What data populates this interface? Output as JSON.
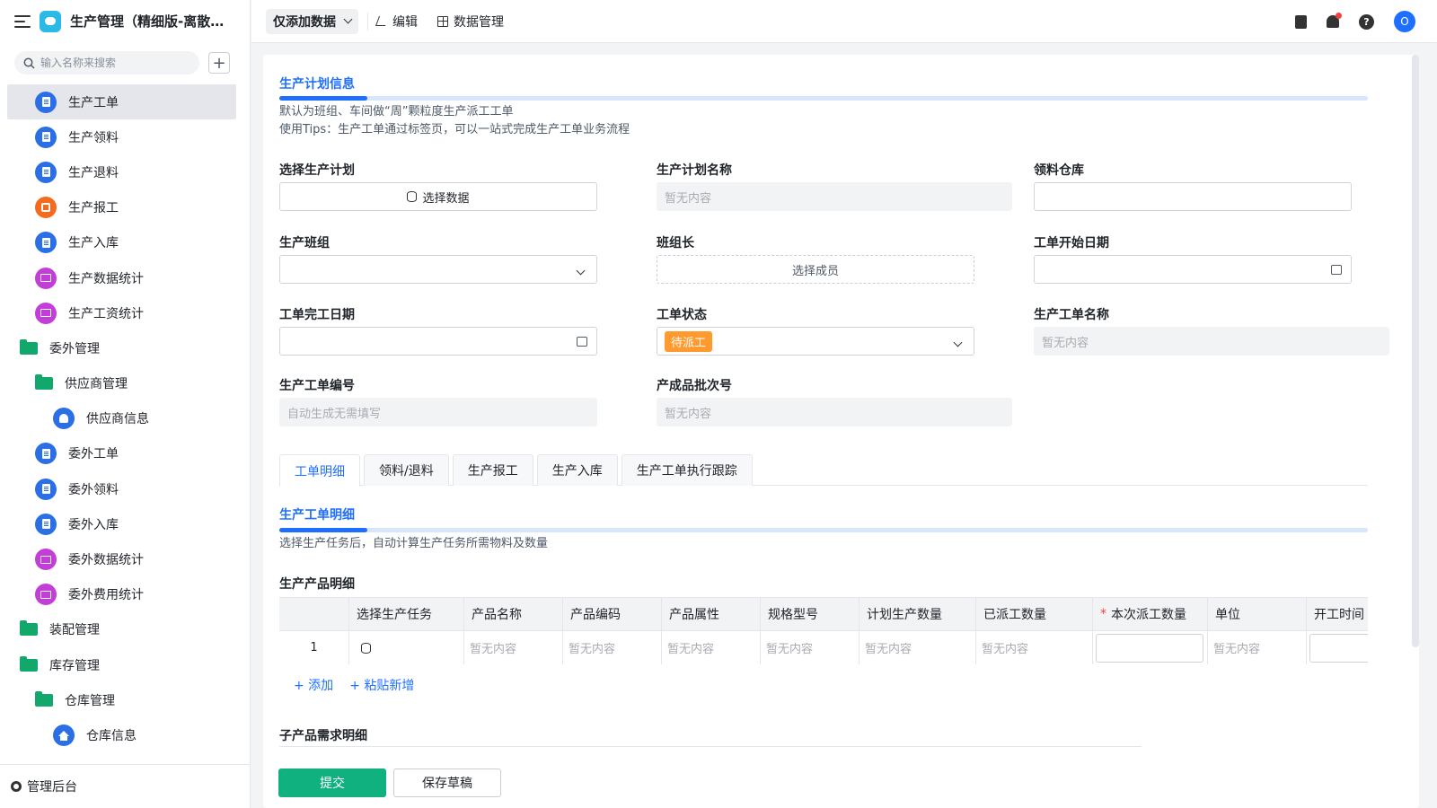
{
  "app": {
    "title": "生产管理（精细版-离散制..."
  },
  "search": {
    "placeholder": "输入名称来搜索"
  },
  "sidebar": {
    "items": [
      {
        "label": "生产工单",
        "active": true
      },
      {
        "label": "生产领料"
      },
      {
        "label": "生产退料"
      },
      {
        "label": "生产报工"
      },
      {
        "label": "生产入库"
      },
      {
        "label": "生产数据统计"
      },
      {
        "label": "生产工资统计"
      },
      {
        "label": "委外管理"
      },
      {
        "label": "供应商管理"
      },
      {
        "label": "供应商信息"
      },
      {
        "label": "委外工单"
      },
      {
        "label": "委外领料"
      },
      {
        "label": "委外入库"
      },
      {
        "label": "委外数据统计"
      },
      {
        "label": "委外费用统计"
      },
      {
        "label": "装配管理"
      },
      {
        "label": "库存管理"
      },
      {
        "label": "仓库管理"
      },
      {
        "label": "仓库信息"
      }
    ],
    "footer": "管理后台"
  },
  "topbar": {
    "mode": "仅添加数据",
    "edit": "编辑",
    "data_manage": "数据管理",
    "avatar": "O",
    "help": "?"
  },
  "plan_section": {
    "title": "生产计划信息",
    "hint1": "默认为班组、车间做“周”颗粒度生产派工工单",
    "hint2": "使用Tips：生产工单通过标签页，可以一站式完成生产工单业务流程"
  },
  "fields": {
    "select_plan": {
      "label": "选择生产计划",
      "button": "选择数据"
    },
    "plan_name": {
      "label": "生产计划名称",
      "placeholder": "暂无内容"
    },
    "warehouse": {
      "label": "领料仓库"
    },
    "team": {
      "label": "生产班组"
    },
    "team_leader": {
      "label": "班组长",
      "button": "选择成员"
    },
    "start_date": {
      "label": "工单开始日期"
    },
    "end_date": {
      "label": "工单完工日期"
    },
    "status": {
      "label": "工单状态",
      "value": "待派工"
    },
    "order_name": {
      "label": "生产工单名称",
      "placeholder": "暂无内容"
    },
    "order_no": {
      "label": "生产工单编号",
      "placeholder": "自动生成无需填写"
    },
    "batch_no": {
      "label": "产成品批次号",
      "placeholder": "暂无内容"
    }
  },
  "tabs": [
    "工单明细",
    "领料/退料",
    "生产报工",
    "生产入库",
    "生产工单执行跟踪"
  ],
  "detail_section": {
    "title": "生产工单明细",
    "hint": "选择生产任务后，自动计算生产任务所需物料及数量",
    "table_title": "生产产品明细"
  },
  "table": {
    "columns": [
      "",
      "选择生产任务",
      "产品名称",
      "产品编码",
      "产品属性",
      "规格型号",
      "计划生产数量",
      "已派工数量",
      "本次派工数量",
      "单位",
      "开工时间"
    ],
    "required_mark": "*",
    "row": {
      "index": "1",
      "empty": "暂无内容"
    }
  },
  "actions": {
    "add": "+ 添加",
    "paste": "+ 粘贴新增"
  },
  "sub_section": {
    "title": "子产品需求明细"
  },
  "footer": {
    "submit": "提交",
    "save_draft": "保存草稿"
  }
}
